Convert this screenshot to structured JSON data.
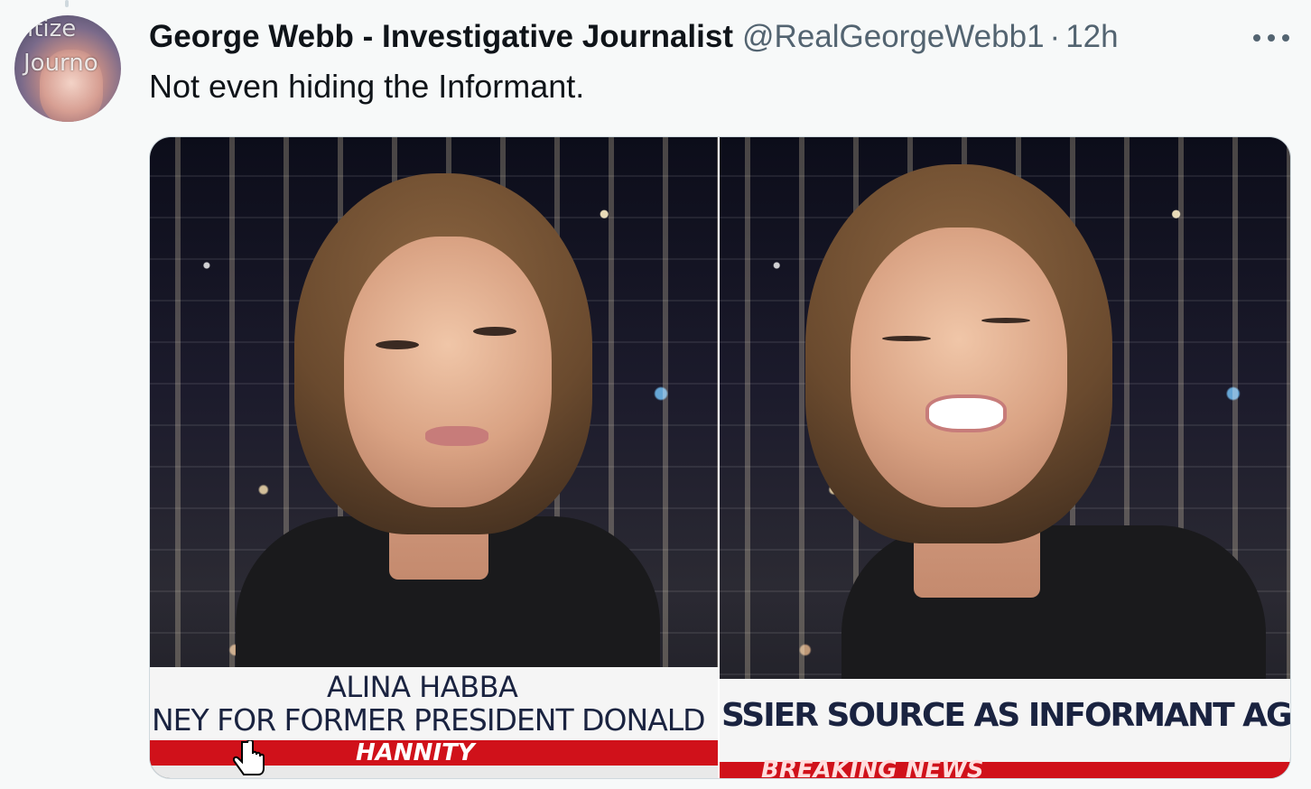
{
  "tweet": {
    "author_name": "George Webb - Investigative Journalist",
    "handle": "@RealGeorgeWebb1",
    "separator": "·",
    "time": "12h",
    "text": "Not even hiding the Informant.",
    "avatar_text_1": "itize",
    "avatar_text_2": "Journo"
  },
  "media": {
    "left": {
      "chyron_name": "ALINA HABBA",
      "chyron_line": "NEY FOR FORMER PRESIDENT DONALD",
      "show_label": "HANNITY"
    },
    "right": {
      "chyron_line": "SSIER SOURCE AS INFORMANT AGAINST TR",
      "banner_label": "BREAKING NEWS"
    }
  },
  "colors": {
    "handle_gray": "#536471",
    "text_dark": "#0f1419",
    "fox_red": "#d0111a",
    "chyron_navy": "#1a2340"
  }
}
